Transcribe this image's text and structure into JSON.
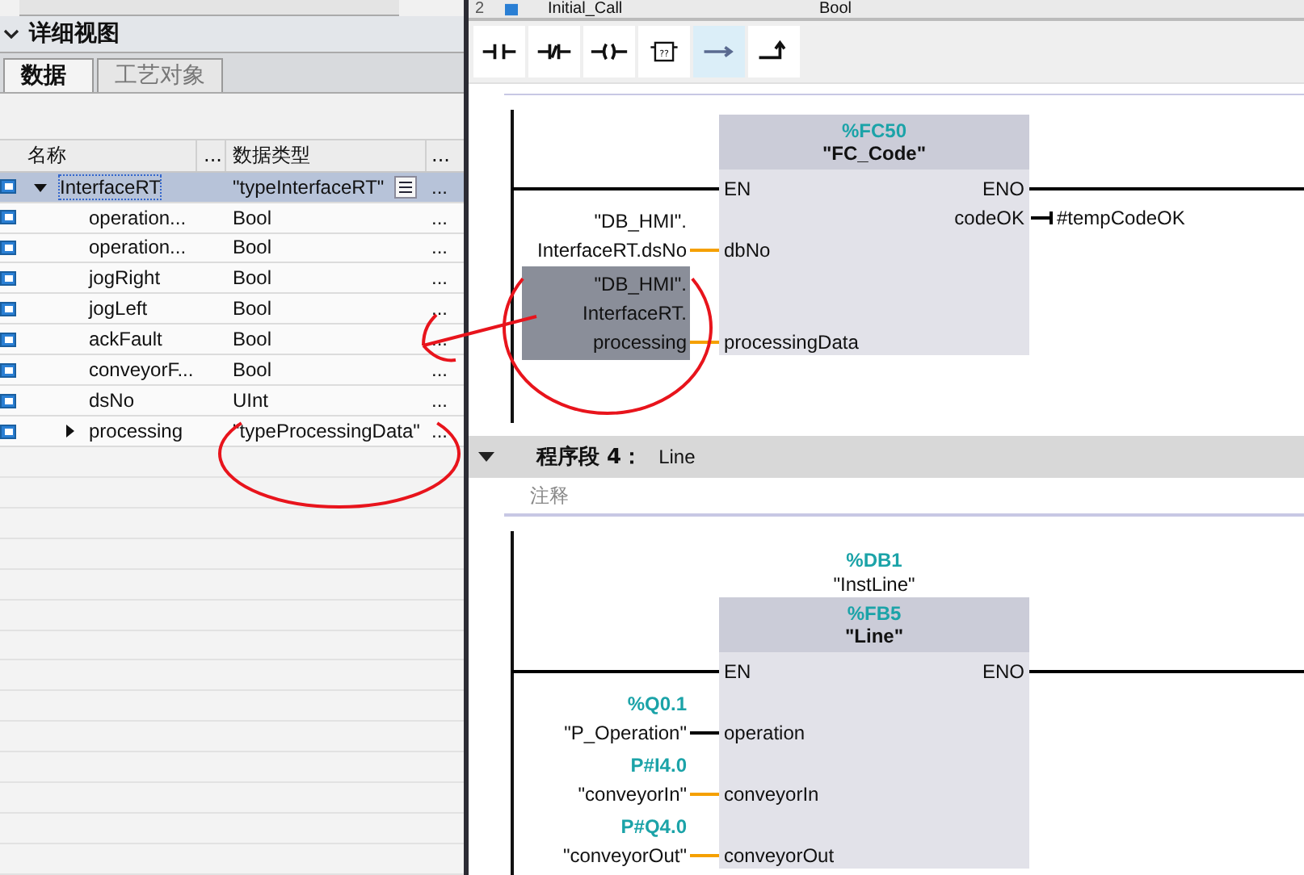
{
  "top_strip": {
    "row_number": "2",
    "name": "Initial_Call",
    "type": "Bool"
  },
  "detail_view": {
    "title": "详细视图",
    "tabs": [
      {
        "label": "数据",
        "selected": true
      },
      {
        "label": "工艺对象",
        "selected": false
      }
    ],
    "columns": [
      "名称",
      "...",
      "数据类型",
      "..."
    ],
    "rows": [
      {
        "name": "InterfaceRT",
        "type": "\"typeInterfaceRT\"",
        "more": "...",
        "selected": true,
        "expanded": true,
        "children": [
          {
            "name": "operation...",
            "type": "Bool",
            "more": "...",
            "selected": false
          },
          {
            "name": "operation...",
            "type": "Bool",
            "more": "...",
            "selected": false
          },
          {
            "name": "jogRight",
            "type": "Bool",
            "more": "...",
            "selected": false
          },
          {
            "name": "jogLeft",
            "type": "Bool",
            "more": "...",
            "selected": false
          },
          {
            "name": "ackFault",
            "type": "Bool",
            "more": "...",
            "selected": false
          },
          {
            "name": "conveyorF...",
            "type": "Bool",
            "more": "...",
            "selected": false
          },
          {
            "name": "dsNo",
            "type": "UInt",
            "more": "...",
            "selected": false
          },
          {
            "name": "processing",
            "type": "\"typeProcessingData\"",
            "more": "...",
            "selected": false,
            "expanded": false
          }
        ]
      }
    ]
  },
  "toolbar": [
    {
      "kind": "no_contact",
      "selected": false
    },
    {
      "kind": "nc_contact",
      "selected": false
    },
    {
      "kind": "coil",
      "selected": false
    },
    {
      "kind": "empty_box",
      "label": "??",
      "selected": false
    },
    {
      "kind": "open_branch",
      "selected": true
    },
    {
      "kind": "close_branch",
      "selected": false
    }
  ],
  "networks": [
    {
      "block": {
        "address": "%FC50",
        "name": "\"FC_Code\"",
        "en": "EN",
        "eno": "ENO"
      },
      "inputs": [
        {
          "pin": "dbNo",
          "symbol": [
            "\"DB_HMI\".",
            "InterfaceRT.dsNo"
          ],
          "color": "#f5a000",
          "highlighted": false
        },
        {
          "pin": "processingData",
          "symbol": [
            "\"DB_HMI\".",
            "InterfaceRT.",
            "processing"
          ],
          "color": "#f5a000",
          "highlighted": true
        }
      ],
      "outputs": [
        {
          "pin": "codeOK",
          "operand": "#tempCodeOK"
        }
      ]
    },
    {
      "header": {
        "title": "程序段 4：",
        "name": "Line",
        "comment": "注释",
        "expanded": true
      },
      "instance": {
        "address": "%DB1",
        "name": "\"InstLine\""
      },
      "block": {
        "address": "%FB5",
        "name": "\"Line\"",
        "en": "EN",
        "eno": "ENO"
      },
      "inputs": [
        {
          "pin": "operation",
          "address": "%Q0.1",
          "symbol": [
            "\"P_Operation\""
          ],
          "color": "#000000",
          "highlighted": false
        },
        {
          "pin": "conveyorIn",
          "address": "P#I4.0",
          "symbol": [
            "\"conveyorIn\""
          ],
          "color": "#f5a000",
          "highlighted": false
        },
        {
          "pin": "conveyorOut",
          "address": "P#Q4.0",
          "symbol": [
            "\"conveyorOut\""
          ],
          "color": "#f5a000",
          "highlighted": false
        }
      ]
    }
  ],
  "annotations": [
    {
      "kind": "circle"
    },
    {
      "kind": "circle"
    },
    {
      "kind": "arrow"
    }
  ]
}
